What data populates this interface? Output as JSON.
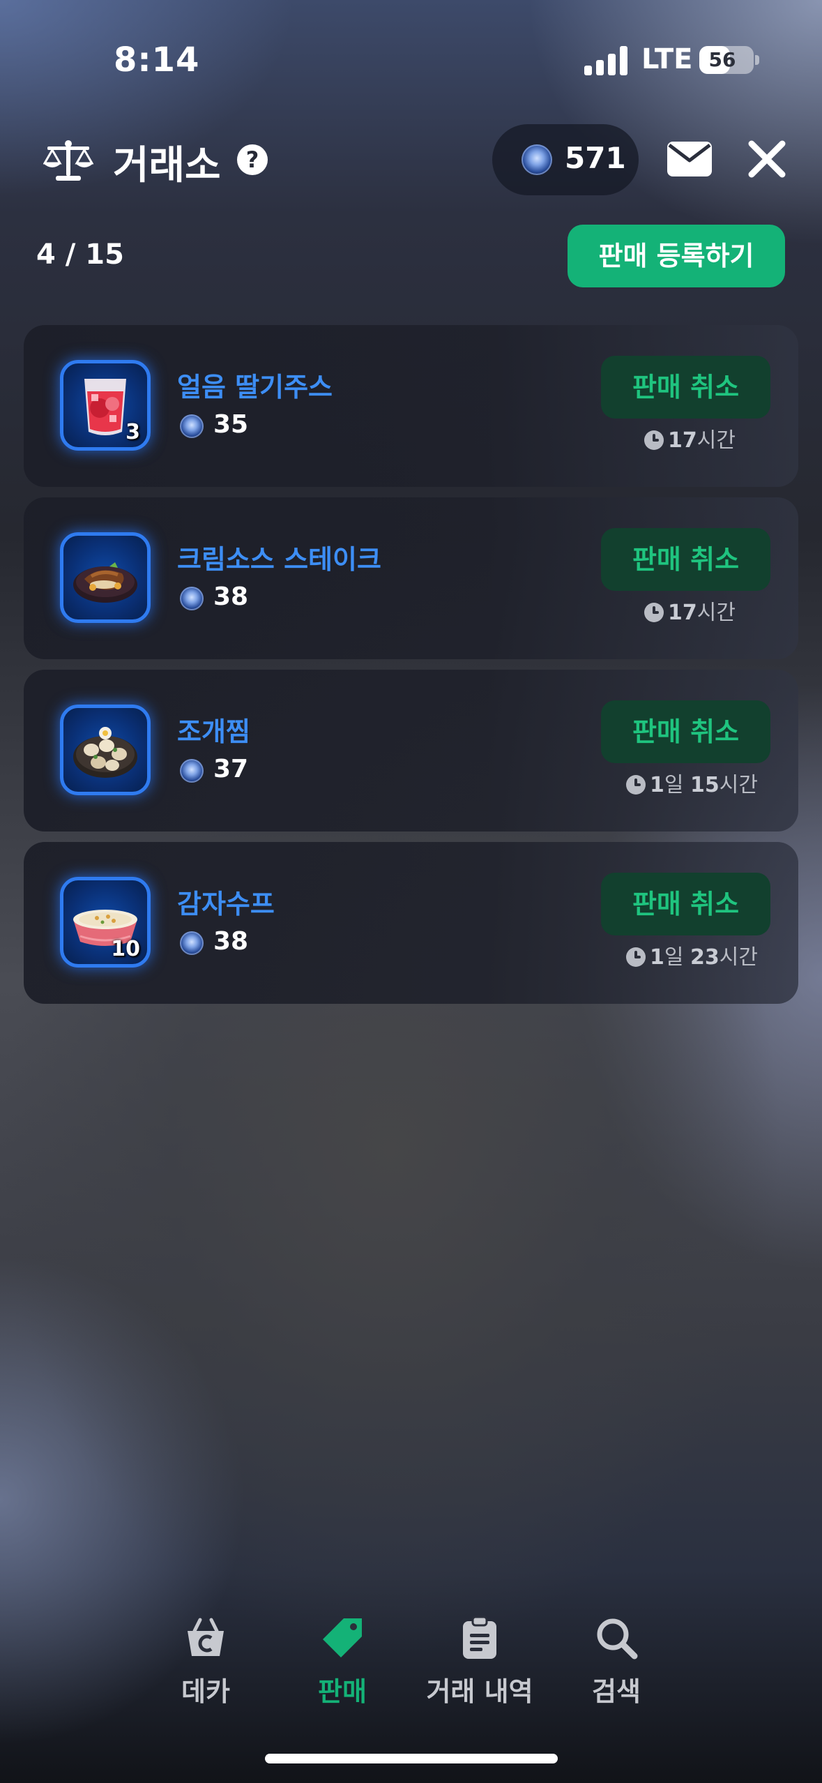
{
  "status_bar": {
    "time": "8:14",
    "network": "LTE",
    "battery": "56",
    "battery_level": 0.56
  },
  "header": {
    "title": "거래소",
    "help_icon": "question-circle-icon",
    "currency_amount": "571",
    "mail_icon": "envelope-icon",
    "close_icon": "close-icon"
  },
  "listing": {
    "count": "4 / 15",
    "register_label": "판매 등록하기"
  },
  "items": [
    {
      "name": "얼음 딸기주스",
      "icon": "strawberry-juice-icon",
      "quantity": "3",
      "price": "35",
      "cancel_label": "판매 취소",
      "time_num1": "17",
      "time_unit1": "시간",
      "time_num2": "",
      "time_unit2": ""
    },
    {
      "name": "크림소스 스테이크",
      "icon": "cream-steak-icon",
      "quantity": "",
      "price": "38",
      "cancel_label": "판매 취소",
      "time_num1": "17",
      "time_unit1": "시간",
      "time_num2": "",
      "time_unit2": ""
    },
    {
      "name": "조개찜",
      "icon": "steamed-clams-icon",
      "quantity": "",
      "price": "37",
      "cancel_label": "판매 취소",
      "time_num1": "1",
      "time_unit1": "일 ",
      "time_num2": "15",
      "time_unit2": "시간"
    },
    {
      "name": "감자수프",
      "icon": "potato-soup-icon",
      "quantity": "10",
      "price": "38",
      "cancel_label": "판매 취소",
      "time_num1": "1",
      "time_unit1": "일 ",
      "time_num2": "23",
      "time_unit2": "시간"
    }
  ],
  "bottom_nav": [
    {
      "label": "데카",
      "icon": "basket-icon",
      "active": false
    },
    {
      "label": "판매",
      "icon": "tag-icon",
      "active": true
    },
    {
      "label": "거래 내역",
      "icon": "clipboard-icon",
      "active": false
    },
    {
      "label": "검색",
      "icon": "search-icon",
      "active": false
    }
  ],
  "colors": {
    "accent_green": "#14b277",
    "cancel_bg": "#12402e",
    "item_name_blue": "#3d8ef5",
    "icon_border_blue": "#2f7bf0"
  }
}
